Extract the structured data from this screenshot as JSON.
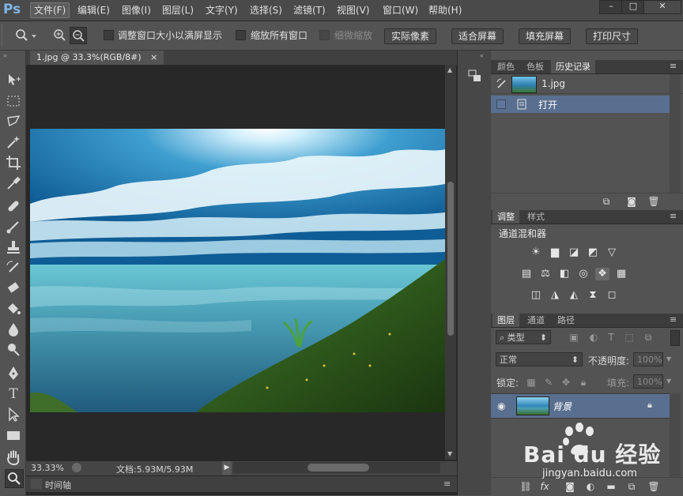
{
  "app": {
    "logo": "Ps"
  },
  "menu": [
    "文件(F)",
    "编辑(E)",
    "图像(I)",
    "图层(L)",
    "文字(Y)",
    "选择(S)",
    "滤镜(T)",
    "视图(V)",
    "窗口(W)",
    "帮助(H)"
  ],
  "window_buttons": {
    "minimize": "–",
    "maximize": "□",
    "close": "✕"
  },
  "options": {
    "checkbox_resize": "调整窗口大小以满屏显示",
    "checkbox_zoom_all": "缩放所有窗口",
    "checkbox_scrubby": "细微缩放",
    "btn_actual_pixels": "实际像素",
    "btn_fit_screen": "适合屏幕",
    "btn_fill_screen": "填充屏幕",
    "btn_print_size": "打印尺寸"
  },
  "document": {
    "tab_label": "1.jpg @ 33.3%(RGB/8#)",
    "tab_close": "×",
    "zoom": "33.33%",
    "doc_info": "文档:5.93M/5.93M"
  },
  "timeline": {
    "label": "时间轴"
  },
  "history_panel": {
    "tabs": [
      "颜色",
      "色板",
      "历史记录"
    ],
    "snapshot_name": "1.jpg",
    "items": [
      "打开"
    ]
  },
  "adjust_panel": {
    "tabs": [
      "调整",
      "样式"
    ],
    "current": "通道混和器"
  },
  "layers_panel": {
    "tabs": [
      "图层",
      "通道",
      "路径"
    ],
    "filter_kind": "类型",
    "blend_mode": "正常",
    "opacity_label": "不透明度:",
    "opacity_value": "100%",
    "lock_label": "锁定:",
    "fill_label": "填充:",
    "fill_value": "100%",
    "layer_name": "背景"
  },
  "watermark": {
    "text": "Bai du 经验",
    "sub": "jingyan.baidu.com"
  },
  "colors": {
    "menubar": "#4a4a4a",
    "panel": "#535353",
    "canvas_bg": "#282828",
    "selected_row": "#596f8f",
    "accent": "#7fb6e8"
  }
}
